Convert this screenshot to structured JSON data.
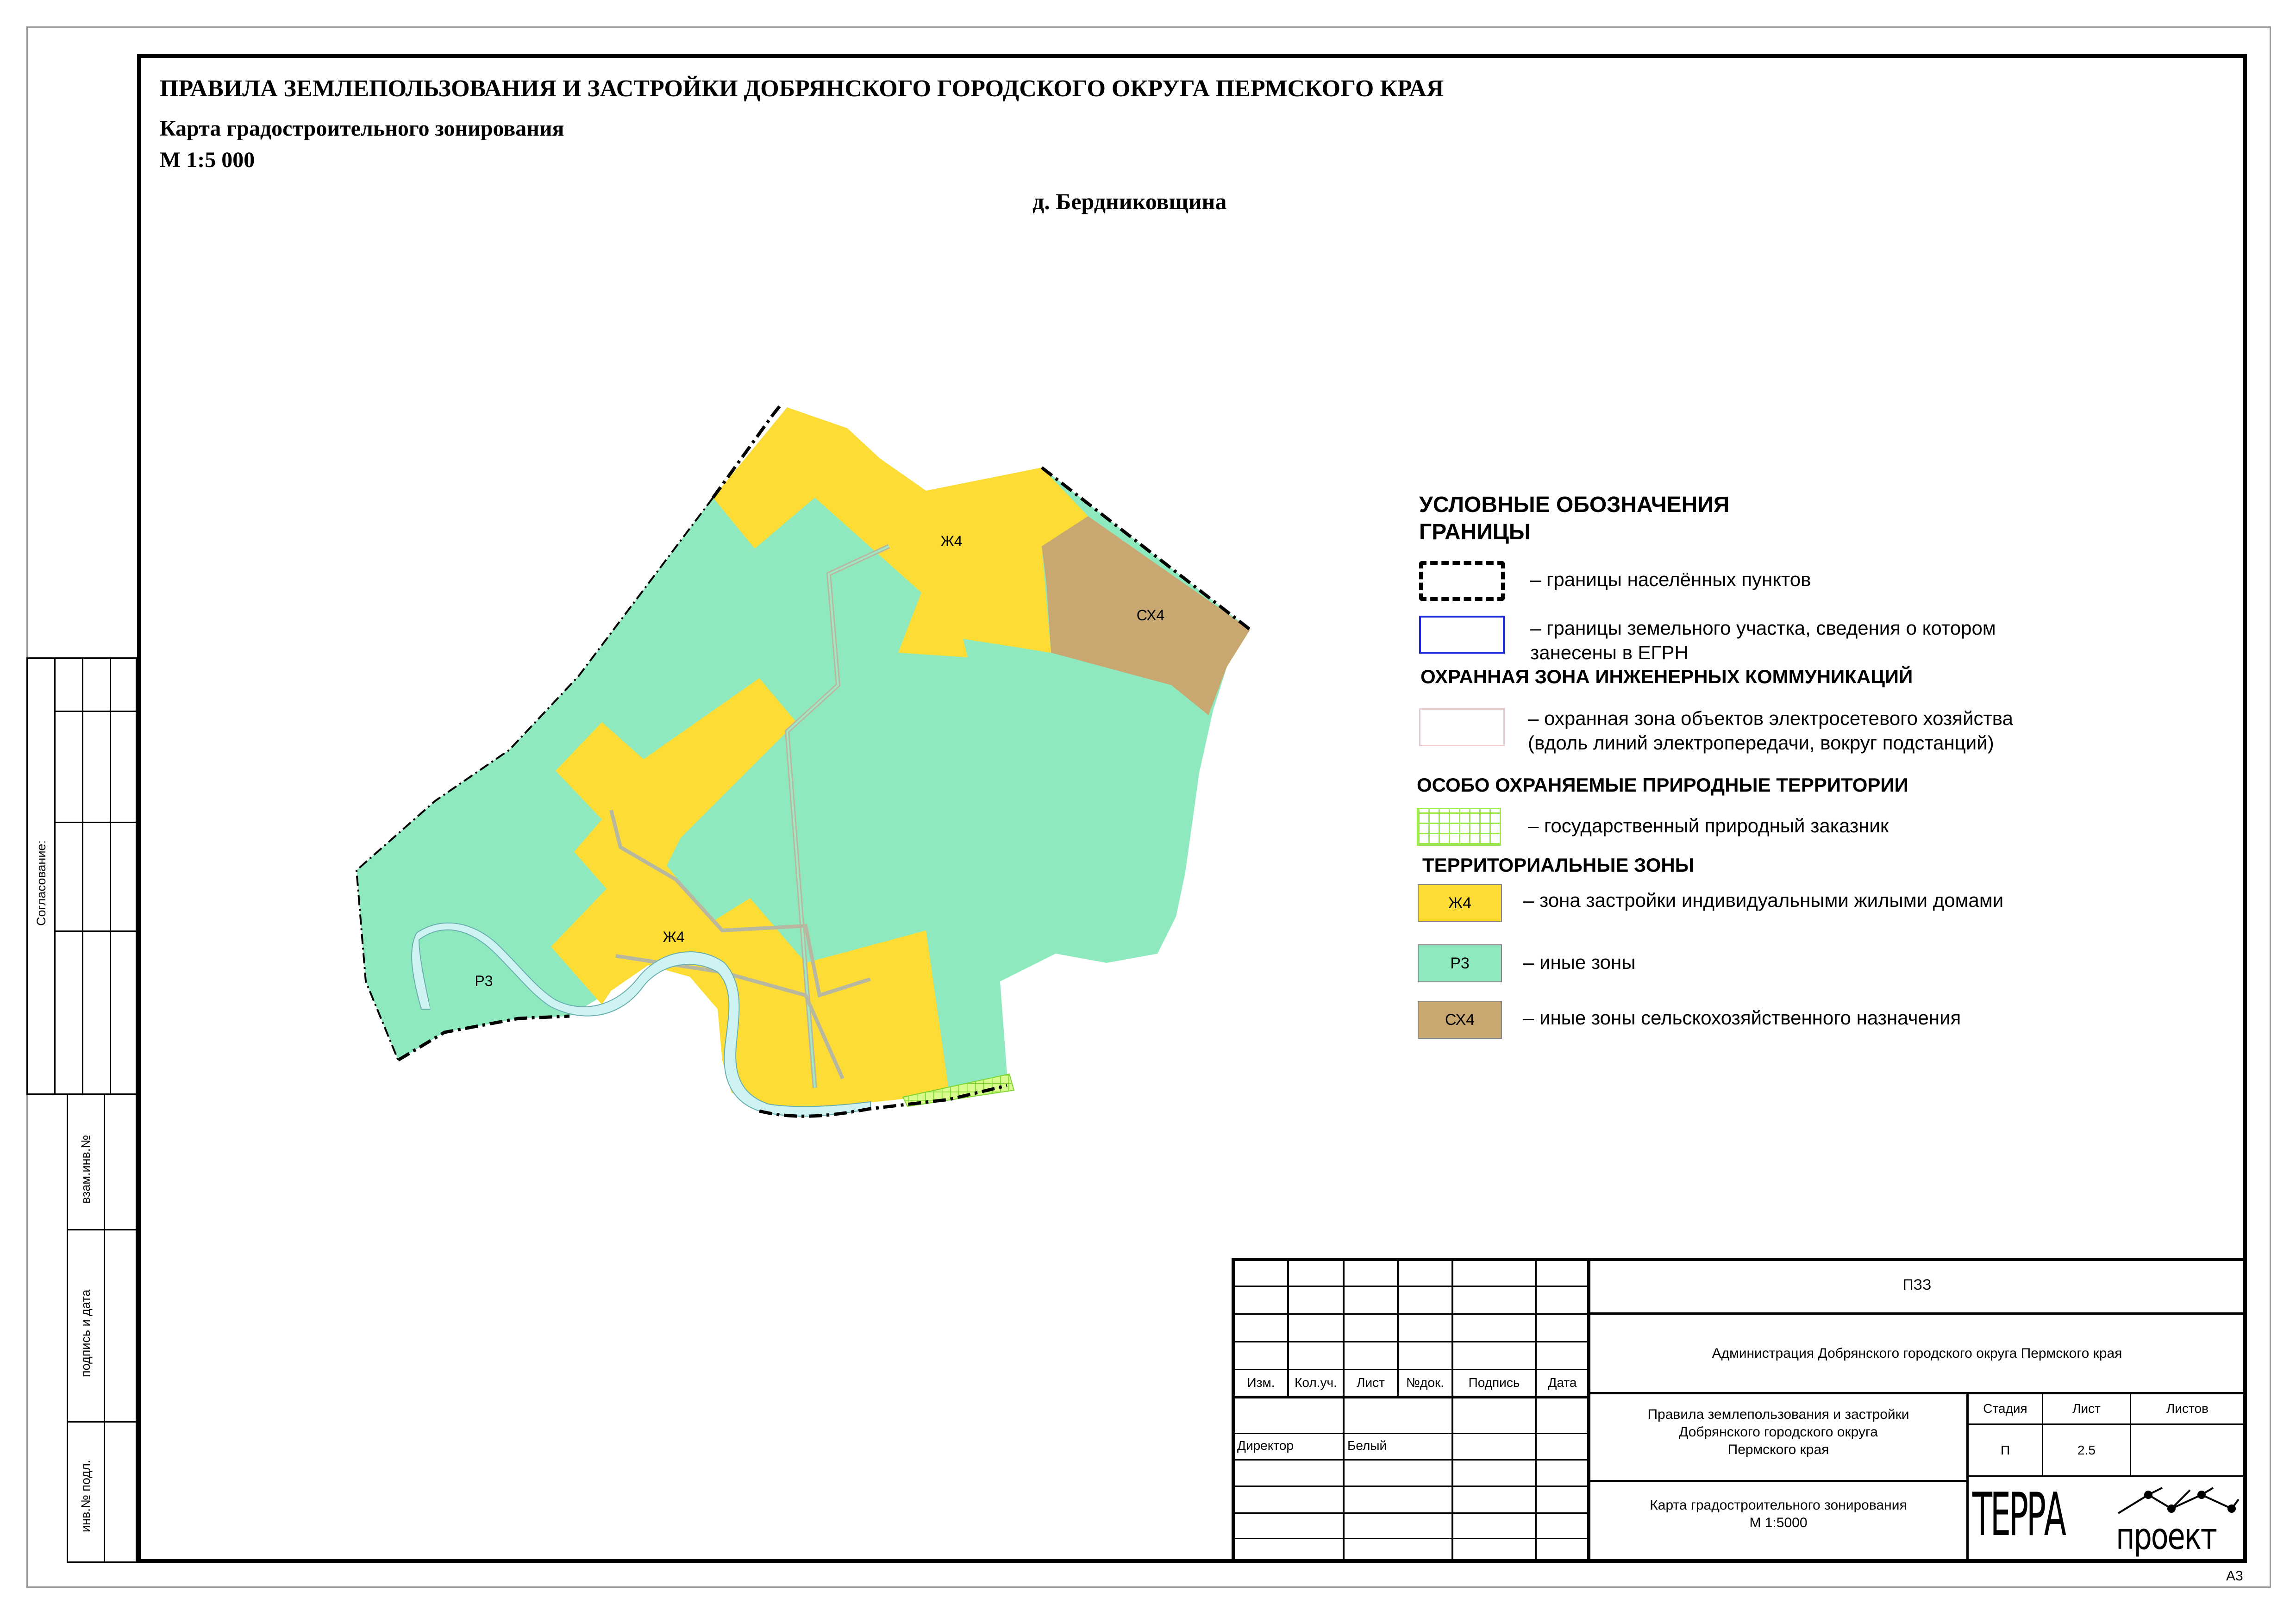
{
  "header": {
    "title": "ПРАВИЛА ЗЕМЛЕПОЛЬЗОВАНИЯ И ЗАСТРОЙКИ ДОБРЯНСКОГО ГОРОДСКОГО ОКРУГА ПЕРМСКОГО КРАЯ",
    "subtitle": "Карта градостроительного зонирования",
    "scale": "М 1:5 000",
    "settlement": "д. Бердниковщина"
  },
  "map": {
    "labels": {
      "zh4_top": "Ж4",
      "sx4": "СХ4",
      "zh4_bottom": "Ж4",
      "r3": "Р3"
    },
    "colors": {
      "zh4": "#FCDC35",
      "r3": "#8EEABE",
      "sx4": "#C8A870",
      "river": "#CFF3F3",
      "reserve": "#A8F050"
    }
  },
  "legend": {
    "heading": "УСЛОВНЫЕ ОБОЗНАЧЕНИЯ",
    "borders_heading": "ГРАНИЦЫ",
    "settlement_border": "– границы населённых пунктов",
    "parcel_border_1": "– границы земельного участка, сведения о котором",
    "parcel_border_2": "занесены в ЕГРН",
    "engineering_heading": "ОХРАННАЯ ЗОНА ИНЖЕНЕРНЫХ КОММУНИКАЦИЙ",
    "power_zone_1": "– охранная зона объектов электросетевого хозяйства",
    "power_zone_2": "(вдоль линий электропередачи, вокруг подстанций)",
    "protected_heading": "ОСОБО ОХРАНЯЕМЫЕ ПРИРОДНЫЕ ТЕРРИТОРИИ",
    "reserve": "– государственный природный заказник",
    "zones_heading": "ТЕРРИТОРИАЛЬНЫЕ ЗОНЫ",
    "zh4_code": "Ж4",
    "zh4_text": "– зона застройки индивидуальными жилыми домами",
    "r3_code": "Р3",
    "r3_text": "– иные зоны",
    "sx4_code": "СХ4",
    "sx4_text": "– иные зоны сельскохозяйственного назначения"
  },
  "side_stamp": {
    "agreement": "Согласование:",
    "replace_inv": "взам.инв.№",
    "sign_date": "подпись и дата",
    "inv_orig": "инв.№ подл."
  },
  "title_block": {
    "code": "ПЗЗ",
    "organization": "Администрация Добрянского городского округа Пермского края",
    "columns": [
      "Изм.",
      "Кол.уч.",
      "Лист",
      "№док.",
      "Подпись",
      "Дата"
    ],
    "role": "Директор",
    "name": "Белый",
    "doc_line1": "Правила землепользования и застройки",
    "doc_line2": "Добрянского городского округа",
    "doc_line3": "Пермского края",
    "stage_label": "Стадия",
    "sheet_label": "Лист",
    "sheets_label": "Листов",
    "stage": "П",
    "sheet": "2.5",
    "map_line1": "Карта градостроительного зонирования",
    "map_line2": "М 1:5000",
    "logo_main": "ТЕРРА",
    "logo_sub": "проект",
    "format": "А3"
  }
}
